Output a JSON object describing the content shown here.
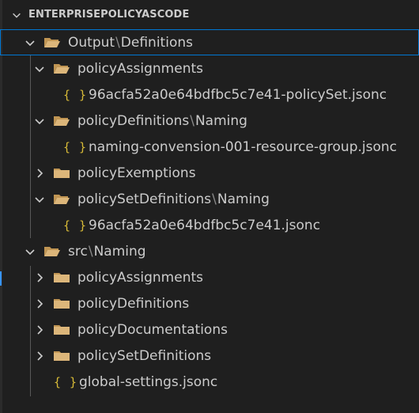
{
  "explorer": {
    "section_title": "ENTERPRISEPOLICYASCODE",
    "path_separator": "\\",
    "colors": {
      "background": "#1f1f1f",
      "text": "#cccccc",
      "folder": "#c09553",
      "json_icon": "#d7ba37",
      "selection_border": "#0078d4"
    },
    "icons": {
      "expanded": "chevron-down-icon",
      "collapsed": "chevron-right-icon",
      "folder": "folder-icon",
      "folder_open": "folder-open-icon",
      "json_file": "json-braces-icon"
    },
    "json_icon_glyph": "{ }",
    "items": [
      {
        "type": "folder",
        "name": "Output",
        "sub": "Definitions",
        "expanded": true,
        "selected": true
      },
      {
        "type": "folder",
        "name": "policyAssignments",
        "expanded": true
      },
      {
        "type": "file",
        "name": "96acfa52a0e64bdfbc5c7e41-policySet.jsonc"
      },
      {
        "type": "folder",
        "name": "policyDefinitions",
        "sub": "Naming",
        "expanded": true
      },
      {
        "type": "file",
        "name": "naming-convension-001-resource-group.jsonc"
      },
      {
        "type": "folder",
        "name": "policyExemptions",
        "expanded": false
      },
      {
        "type": "folder",
        "name": "policySetDefinitions",
        "sub": "Naming",
        "expanded": true
      },
      {
        "type": "file",
        "name": "96acfa52a0e64bdfbc5c7e41.jsonc"
      },
      {
        "type": "folder",
        "name": "src",
        "sub": "Naming",
        "expanded": true
      },
      {
        "type": "folder",
        "name": "policyAssignments",
        "expanded": false
      },
      {
        "type": "folder",
        "name": "policyDefinitions",
        "expanded": false
      },
      {
        "type": "folder",
        "name": "policyDocumentations",
        "expanded": false
      },
      {
        "type": "folder",
        "name": "policySetDefinitions",
        "expanded": false
      },
      {
        "type": "file",
        "name": "global-settings.jsonc"
      }
    ]
  }
}
